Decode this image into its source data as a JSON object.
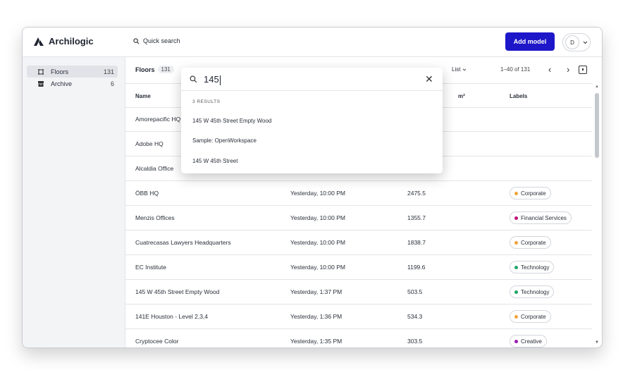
{
  "app": {
    "name": "Archilogic"
  },
  "header": {
    "quick_search": "Quick search",
    "add_model": "Add model",
    "avatar_initial": "D"
  },
  "sidebar": {
    "items": [
      {
        "label": "Floors",
        "count": "131"
      },
      {
        "label": "Archive",
        "count": "6"
      }
    ]
  },
  "toolbar": {
    "title": "Floors",
    "count": "131",
    "view": "List",
    "pager": "1–40 of 131"
  },
  "table": {
    "headers": {
      "name": "Name",
      "area": "m²",
      "labels": "Labels"
    },
    "rows": [
      {
        "name": "Amorepacific HQ",
        "date": "",
        "area": "",
        "label": "",
        "label_color": ""
      },
      {
        "name": "Adobe HQ",
        "date": "",
        "area": "",
        "label": "",
        "label_color": ""
      },
      {
        "name": "Alcaldia Office",
        "date": "",
        "area": "",
        "label": "",
        "label_color": ""
      },
      {
        "name": "ÖBB HQ",
        "date": "Yesterday, 10:00 PM",
        "area": "2475.5",
        "label": "Corporate",
        "label_color": "#f0a33a"
      },
      {
        "name": "Menzis Offices",
        "date": "Yesterday, 10:00 PM",
        "area": "1355.7",
        "label": "Financial Services",
        "label_color": "#c2127a"
      },
      {
        "name": "Cuatrecasas Lawyers Headquarters",
        "date": "Yesterday, 10:00 PM",
        "area": "1838.7",
        "label": "Corporate",
        "label_color": "#f0a33a"
      },
      {
        "name": "EC Institute",
        "date": "Yesterday, 10:00 PM",
        "area": "1199.6",
        "label": "Technology",
        "label_color": "#1fa66a"
      },
      {
        "name": "145 W 45th Street Empty Wood",
        "date": "Yesterday, 1:37 PM",
        "area": "503.5",
        "label": "Technology",
        "label_color": "#1fa66a"
      },
      {
        "name": "141E Houston - Level 2,3,4",
        "date": "Yesterday, 1:36 PM",
        "area": "534.3",
        "label": "Corporate",
        "label_color": "#f0a33a"
      },
      {
        "name": "Cryptocee Color",
        "date": "Yesterday, 1:35 PM",
        "area": "303.5",
        "label": "Creative",
        "label_color": "#9b1bb5"
      }
    ]
  },
  "search": {
    "query": "145",
    "results_label": "3 RESULTS",
    "results": [
      "145 W 45th Street Empty Wood",
      "Sample: OpenWorkspace",
      "145 W 45th Street"
    ]
  },
  "colors": {
    "accent": "#1d17c9"
  }
}
